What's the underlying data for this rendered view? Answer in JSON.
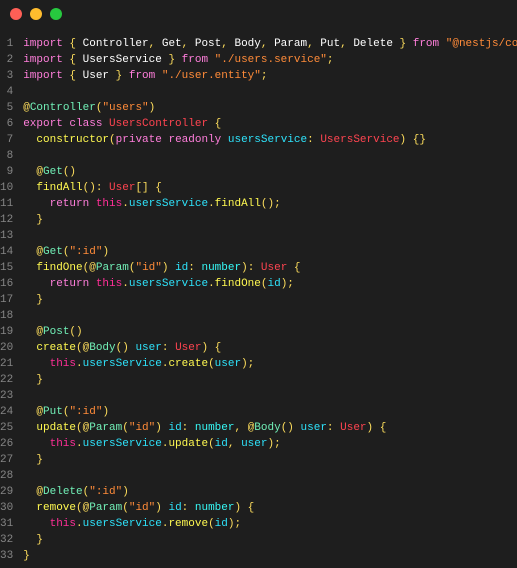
{
  "titlebar": {
    "buttons": [
      "close",
      "minimize",
      "maximize"
    ]
  },
  "colors": {
    "keyword_pink": "#ff7edb",
    "punct_yellow": "#fede5d",
    "string_orange": "#ff8b39",
    "func_yellow": "#fff951",
    "type_cyan": "#36f9f6",
    "class_orange": "#fe4450",
    "decorator_green": "#72f1b8",
    "param_blue": "#2ee2fa",
    "var_pink": "#ff2e97",
    "ident_white": "#ffffff",
    "comment": "#848bbd"
  },
  "code_lines": [
    [
      [
        "import",
        "keyword_pink"
      ],
      [
        " { ",
        "punct_yellow"
      ],
      [
        "Controller",
        "ident_white"
      ],
      [
        ", ",
        "punct_yellow"
      ],
      [
        "Get",
        "ident_white"
      ],
      [
        ", ",
        "punct_yellow"
      ],
      [
        "Post",
        "ident_white"
      ],
      [
        ", ",
        "punct_yellow"
      ],
      [
        "Body",
        "ident_white"
      ],
      [
        ", ",
        "punct_yellow"
      ],
      [
        "Param",
        "ident_white"
      ],
      [
        ", ",
        "punct_yellow"
      ],
      [
        "Put",
        "ident_white"
      ],
      [
        ", ",
        "punct_yellow"
      ],
      [
        "Delete",
        "ident_white"
      ],
      [
        " } ",
        "punct_yellow"
      ],
      [
        "from",
        "keyword_pink"
      ],
      [
        " ",
        "ident_white"
      ],
      [
        "\"@nestjs/common\"",
        "string_orange"
      ],
      [
        ";",
        "punct_yellow"
      ]
    ],
    [
      [
        "import",
        "keyword_pink"
      ],
      [
        " { ",
        "punct_yellow"
      ],
      [
        "UsersService",
        "ident_white"
      ],
      [
        " } ",
        "punct_yellow"
      ],
      [
        "from",
        "keyword_pink"
      ],
      [
        " ",
        "ident_white"
      ],
      [
        "\"./users.service\"",
        "string_orange"
      ],
      [
        ";",
        "punct_yellow"
      ]
    ],
    [
      [
        "import",
        "keyword_pink"
      ],
      [
        " { ",
        "punct_yellow"
      ],
      [
        "User",
        "ident_white"
      ],
      [
        " } ",
        "punct_yellow"
      ],
      [
        "from",
        "keyword_pink"
      ],
      [
        " ",
        "ident_white"
      ],
      [
        "\"./user.entity\"",
        "string_orange"
      ],
      [
        ";",
        "punct_yellow"
      ]
    ],
    [],
    [
      [
        "@",
        "punct_yellow"
      ],
      [
        "Controller",
        "decorator_green"
      ],
      [
        "(",
        "punct_yellow"
      ],
      [
        "\"users\"",
        "string_orange"
      ],
      [
        ")",
        "punct_yellow"
      ]
    ],
    [
      [
        "export",
        "keyword_pink"
      ],
      [
        " ",
        "ident_white"
      ],
      [
        "class",
        "keyword_pink"
      ],
      [
        " ",
        "ident_white"
      ],
      [
        "UsersController",
        "class_orange"
      ],
      [
        " {",
        "punct_yellow"
      ]
    ],
    [
      [
        "  ",
        "ident_white"
      ],
      [
        "constructor",
        "func_yellow"
      ],
      [
        "(",
        "punct_yellow"
      ],
      [
        "private",
        "keyword_pink"
      ],
      [
        " ",
        "ident_white"
      ],
      [
        "readonly",
        "keyword_pink"
      ],
      [
        " ",
        "ident_white"
      ],
      [
        "usersService",
        "param_blue"
      ],
      [
        ": ",
        "punct_yellow"
      ],
      [
        "UsersService",
        "class_orange"
      ],
      [
        ") {}",
        "punct_yellow"
      ]
    ],
    [],
    [
      [
        "  ",
        "ident_white"
      ],
      [
        "@",
        "punct_yellow"
      ],
      [
        "Get",
        "decorator_green"
      ],
      [
        "()",
        "punct_yellow"
      ]
    ],
    [
      [
        "  ",
        "ident_white"
      ],
      [
        "findAll",
        "func_yellow"
      ],
      [
        "(): ",
        "punct_yellow"
      ],
      [
        "User",
        "class_orange"
      ],
      [
        "[] {",
        "punct_yellow"
      ]
    ],
    [
      [
        "    ",
        "ident_white"
      ],
      [
        "return",
        "keyword_pink"
      ],
      [
        " ",
        "ident_white"
      ],
      [
        "this",
        "var_pink"
      ],
      [
        ".",
        "punct_yellow"
      ],
      [
        "usersService",
        "param_blue"
      ],
      [
        ".",
        "punct_yellow"
      ],
      [
        "findAll",
        "func_yellow"
      ],
      [
        "();",
        "punct_yellow"
      ]
    ],
    [
      [
        "  ",
        "ident_white"
      ],
      [
        "}",
        "punct_yellow"
      ]
    ],
    [],
    [
      [
        "  ",
        "ident_white"
      ],
      [
        "@",
        "punct_yellow"
      ],
      [
        "Get",
        "decorator_green"
      ],
      [
        "(",
        "punct_yellow"
      ],
      [
        "\":id\"",
        "string_orange"
      ],
      [
        ")",
        "punct_yellow"
      ]
    ],
    [
      [
        "  ",
        "ident_white"
      ],
      [
        "findOne",
        "func_yellow"
      ],
      [
        "(",
        "punct_yellow"
      ],
      [
        "@",
        "punct_yellow"
      ],
      [
        "Param",
        "decorator_green"
      ],
      [
        "(",
        "punct_yellow"
      ],
      [
        "\"id\"",
        "string_orange"
      ],
      [
        ") ",
        "punct_yellow"
      ],
      [
        "id",
        "param_blue"
      ],
      [
        ": ",
        "punct_yellow"
      ],
      [
        "number",
        "type_cyan"
      ],
      [
        "): ",
        "punct_yellow"
      ],
      [
        "User",
        "class_orange"
      ],
      [
        " {",
        "punct_yellow"
      ]
    ],
    [
      [
        "    ",
        "ident_white"
      ],
      [
        "return",
        "keyword_pink"
      ],
      [
        " ",
        "ident_white"
      ],
      [
        "this",
        "var_pink"
      ],
      [
        ".",
        "punct_yellow"
      ],
      [
        "usersService",
        "param_blue"
      ],
      [
        ".",
        "punct_yellow"
      ],
      [
        "findOne",
        "func_yellow"
      ],
      [
        "(",
        "punct_yellow"
      ],
      [
        "id",
        "param_blue"
      ],
      [
        ");",
        "punct_yellow"
      ]
    ],
    [
      [
        "  ",
        "ident_white"
      ],
      [
        "}",
        "punct_yellow"
      ]
    ],
    [],
    [
      [
        "  ",
        "ident_white"
      ],
      [
        "@",
        "punct_yellow"
      ],
      [
        "Post",
        "decorator_green"
      ],
      [
        "()",
        "punct_yellow"
      ]
    ],
    [
      [
        "  ",
        "ident_white"
      ],
      [
        "create",
        "func_yellow"
      ],
      [
        "(",
        "punct_yellow"
      ],
      [
        "@",
        "punct_yellow"
      ],
      [
        "Body",
        "decorator_green"
      ],
      [
        "() ",
        "punct_yellow"
      ],
      [
        "user",
        "param_blue"
      ],
      [
        ": ",
        "punct_yellow"
      ],
      [
        "User",
        "class_orange"
      ],
      [
        ") {",
        "punct_yellow"
      ]
    ],
    [
      [
        "    ",
        "ident_white"
      ],
      [
        "this",
        "var_pink"
      ],
      [
        ".",
        "punct_yellow"
      ],
      [
        "usersService",
        "param_blue"
      ],
      [
        ".",
        "punct_yellow"
      ],
      [
        "create",
        "func_yellow"
      ],
      [
        "(",
        "punct_yellow"
      ],
      [
        "user",
        "param_blue"
      ],
      [
        ");",
        "punct_yellow"
      ]
    ],
    [
      [
        "  ",
        "ident_white"
      ],
      [
        "}",
        "punct_yellow"
      ]
    ],
    [],
    [
      [
        "  ",
        "ident_white"
      ],
      [
        "@",
        "punct_yellow"
      ],
      [
        "Put",
        "decorator_green"
      ],
      [
        "(",
        "punct_yellow"
      ],
      [
        "\":id\"",
        "string_orange"
      ],
      [
        ")",
        "punct_yellow"
      ]
    ],
    [
      [
        "  ",
        "ident_white"
      ],
      [
        "update",
        "func_yellow"
      ],
      [
        "(",
        "punct_yellow"
      ],
      [
        "@",
        "punct_yellow"
      ],
      [
        "Param",
        "decorator_green"
      ],
      [
        "(",
        "punct_yellow"
      ],
      [
        "\"id\"",
        "string_orange"
      ],
      [
        ") ",
        "punct_yellow"
      ],
      [
        "id",
        "param_blue"
      ],
      [
        ": ",
        "punct_yellow"
      ],
      [
        "number",
        "type_cyan"
      ],
      [
        ", ",
        "punct_yellow"
      ],
      [
        "@",
        "punct_yellow"
      ],
      [
        "Body",
        "decorator_green"
      ],
      [
        "() ",
        "punct_yellow"
      ],
      [
        "user",
        "param_blue"
      ],
      [
        ": ",
        "punct_yellow"
      ],
      [
        "User",
        "class_orange"
      ],
      [
        ") {",
        "punct_yellow"
      ]
    ],
    [
      [
        "    ",
        "ident_white"
      ],
      [
        "this",
        "var_pink"
      ],
      [
        ".",
        "punct_yellow"
      ],
      [
        "usersService",
        "param_blue"
      ],
      [
        ".",
        "punct_yellow"
      ],
      [
        "update",
        "func_yellow"
      ],
      [
        "(",
        "punct_yellow"
      ],
      [
        "id",
        "param_blue"
      ],
      [
        ", ",
        "punct_yellow"
      ],
      [
        "user",
        "param_blue"
      ],
      [
        ");",
        "punct_yellow"
      ]
    ],
    [
      [
        "  ",
        "ident_white"
      ],
      [
        "}",
        "punct_yellow"
      ]
    ],
    [],
    [
      [
        "  ",
        "ident_white"
      ],
      [
        "@",
        "punct_yellow"
      ],
      [
        "Delete",
        "decorator_green"
      ],
      [
        "(",
        "punct_yellow"
      ],
      [
        "\":id\"",
        "string_orange"
      ],
      [
        ")",
        "punct_yellow"
      ]
    ],
    [
      [
        "  ",
        "ident_white"
      ],
      [
        "remove",
        "func_yellow"
      ],
      [
        "(",
        "punct_yellow"
      ],
      [
        "@",
        "punct_yellow"
      ],
      [
        "Param",
        "decorator_green"
      ],
      [
        "(",
        "punct_yellow"
      ],
      [
        "\"id\"",
        "string_orange"
      ],
      [
        ") ",
        "punct_yellow"
      ],
      [
        "id",
        "param_blue"
      ],
      [
        ": ",
        "punct_yellow"
      ],
      [
        "number",
        "type_cyan"
      ],
      [
        ") {",
        "punct_yellow"
      ]
    ],
    [
      [
        "    ",
        "ident_white"
      ],
      [
        "this",
        "var_pink"
      ],
      [
        ".",
        "punct_yellow"
      ],
      [
        "usersService",
        "param_blue"
      ],
      [
        ".",
        "punct_yellow"
      ],
      [
        "remove",
        "func_yellow"
      ],
      [
        "(",
        "punct_yellow"
      ],
      [
        "id",
        "param_blue"
      ],
      [
        ");",
        "punct_yellow"
      ]
    ],
    [
      [
        "  ",
        "ident_white"
      ],
      [
        "}",
        "punct_yellow"
      ]
    ],
    [
      [
        "}",
        "punct_yellow"
      ]
    ]
  ]
}
